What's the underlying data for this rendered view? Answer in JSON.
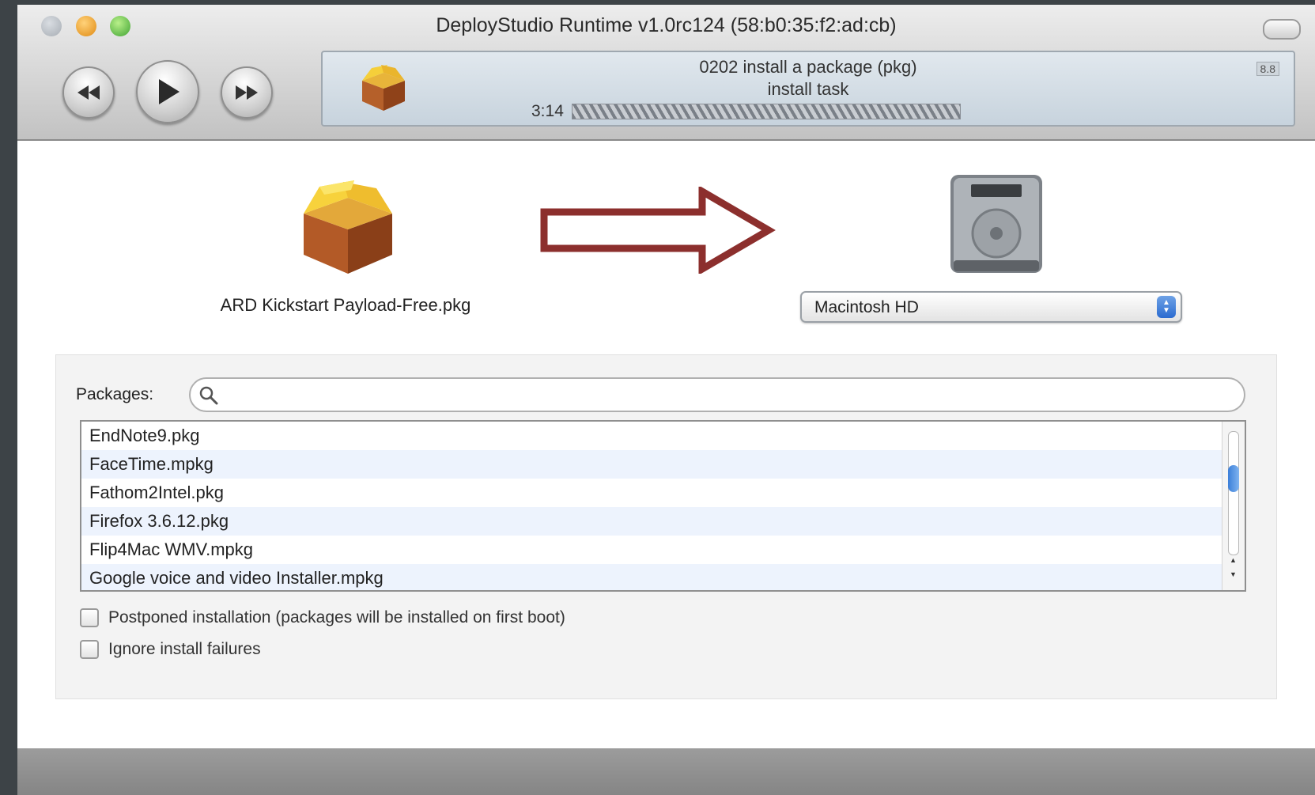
{
  "window": {
    "title": "DeployStudio Runtime v1.0rc124 (58:b0:35:f2:ad:cb)"
  },
  "status": {
    "step": "0202 install a package (pkg)",
    "task": "install task",
    "time": "3:14",
    "badge": "8.8",
    "progress": 1.0
  },
  "transfer": {
    "package_name": "ARD Kickstart Payload-Free.pkg",
    "target_volume": "Macintosh HD"
  },
  "packages": {
    "label": "Packages:",
    "search_placeholder": "",
    "items": [
      "EndNote9.pkg",
      "FaceTime.mpkg",
      "Fathom2Intel.pkg",
      "Firefox 3.6.12.pkg",
      "Flip4Mac WMV.mpkg",
      "Google voice and video Installer.mpkg"
    ]
  },
  "options": {
    "postponed_label": "Postponed installation (packages will be installed on first boot)",
    "postponed_checked": false,
    "ignore_label": "Ignore install failures",
    "ignore_checked": false
  },
  "colors": {
    "arrow": "#8c2f2d",
    "selection": "#edf3fd"
  },
  "icons": {
    "package": "package-box-icon",
    "disk": "hard-disk-icon",
    "search": "magnifier-icon"
  }
}
